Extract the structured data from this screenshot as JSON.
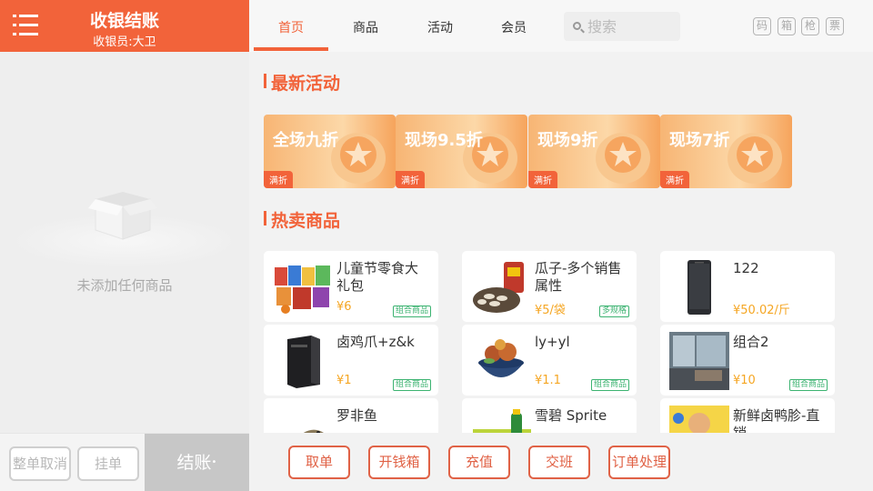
{
  "sidebar": {
    "title": "收银结账",
    "cashier": "收银员:大卫",
    "empty_text": "未添加任何商品",
    "buttons": {
      "cancel_all": "整单取消",
      "hold": "挂单",
      "checkout": "结账"
    }
  },
  "nav": {
    "tabs": [
      "首页",
      "商品",
      "活动",
      "会员"
    ],
    "active_tab": "首页",
    "search_placeholder": "搜索",
    "tools": [
      "码",
      "箱",
      "枪",
      "票"
    ]
  },
  "sections": {
    "activities_title": "最新活动",
    "hot_title": "热卖商品"
  },
  "promotions": [
    {
      "title": "全场九折",
      "tag": "满折"
    },
    {
      "title": "现场9.5折",
      "tag": "满折"
    },
    {
      "title": "现场9折",
      "tag": "满折"
    },
    {
      "title": "现场7折",
      "tag": "满折"
    }
  ],
  "products": [
    {
      "name": "儿童节零食大礼包",
      "price": "¥6",
      "tag": "组合商品",
      "icon": "snack-pack-icon"
    },
    {
      "name": "瓜子-多个销售属性",
      "price": "¥5/袋",
      "tag": "多规格",
      "icon": "sunflower-seeds-icon"
    },
    {
      "name": "122",
      "price": "¥50.02/斤",
      "tag": "",
      "icon": "phone-icon"
    },
    {
      "name": "卤鸡爪+z&k",
      "price": "¥1",
      "tag": "组合商品",
      "icon": "pc-case-icon"
    },
    {
      "name": "ly+yl",
      "price": "¥1.1",
      "tag": "组合商品",
      "icon": "food-bowl-icon"
    },
    {
      "name": "组合2",
      "price": "¥10",
      "tag": "组合商品",
      "icon": "room-photo-icon"
    },
    {
      "name": "罗非鱼",
      "price": "",
      "tag": "",
      "icon": "fish-icon"
    },
    {
      "name": "雪碧 Sprite",
      "price": "",
      "tag": "",
      "icon": "sprite-bottle-icon"
    },
    {
      "name": "新鲜卤鸭胗-直销",
      "price": "",
      "tag": "",
      "icon": "duck-gizzard-icon"
    }
  ],
  "actions": [
    "取单",
    "开钱箱",
    "充值",
    "交班",
    "订单处理"
  ],
  "colors": {
    "accent": "#f2633a",
    "price": "#f5a623",
    "tag_green": "#3cb371"
  }
}
